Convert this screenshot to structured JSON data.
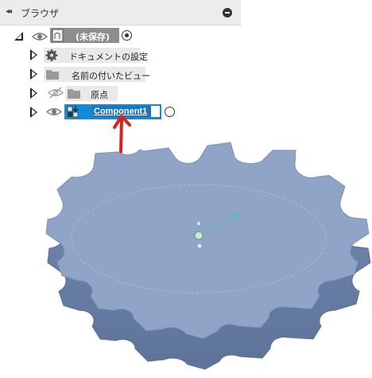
{
  "browser": {
    "title": "ブラウザ",
    "collapse_arrows": "◂◂"
  },
  "tree": {
    "root_label": "(未保存)",
    "items": [
      {
        "label": "ドキュメントの設定",
        "icon": "gear-icon"
      },
      {
        "label": "名前の付いたビュー",
        "icon": "folder-icon"
      },
      {
        "label": "原点",
        "icon": "folder-icon"
      }
    ],
    "component_name": "Component1"
  },
  "colors": {
    "gear_fill": "#8fa4c7",
    "selection": "#0f8bd8",
    "arrow_annotation": "#d8231e"
  }
}
